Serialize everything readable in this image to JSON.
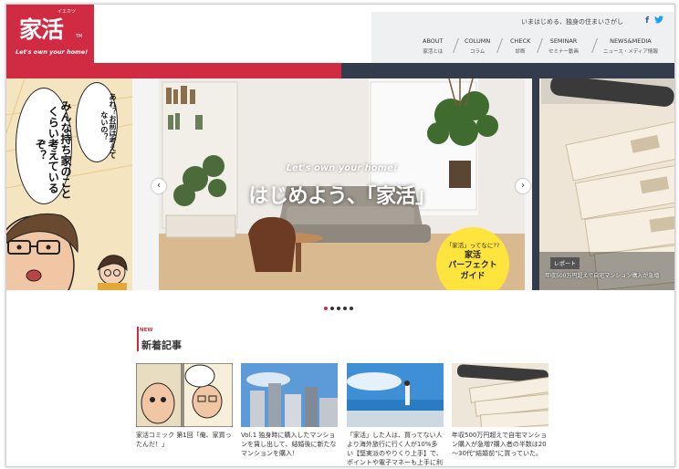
{
  "logo": {
    "sup": "イエカツ",
    "main": "家活",
    "tm": "TM",
    "tag": "Let's own your home!"
  },
  "header": {
    "tagline": "いまはじめる、独身の住まいさがし",
    "facebook": "f",
    "twitter": "🐦",
    "nav": [
      {
        "en": "ABOUT",
        "jp": "家活とは"
      },
      {
        "en": "COLUMN",
        "jp": "コラム"
      },
      {
        "en": "CHECK",
        "jp": "診断"
      },
      {
        "en": "SEMINAR",
        "jp": "セミナー動画"
      },
      {
        "en": "NEWS&MEDIA",
        "jp": "ニュース・メディア情報"
      }
    ]
  },
  "slider": {
    "left_slide": {
      "bubble_main": "みんな持ち家のことくらい考えているぞ？",
      "bubble_small": "あれ？お前は考えてないの？"
    },
    "main_slide": {
      "tagline": "Let's own your home!",
      "headline": "はじめよう、「家活」",
      "badge_line1": "「家活」ってなに??",
      "badge_line2": "家活",
      "badge_line3": "パーフェクト",
      "badge_line4": "ガイド"
    },
    "right_slide": {
      "tag": "レポート",
      "caption": "年収500万円超えで自宅マンション購入が急増"
    },
    "prev_label": "‹",
    "next_label": "›",
    "dots_count": 5,
    "active_dot": 1
  },
  "news": {
    "label_new": "NEW",
    "title": "新着記事",
    "articles": [
      {
        "caption": "家活コミック 第1回「俺、家買ったんだ！」"
      },
      {
        "caption": "Vol.1 独身時に購入したマンションを賃し出して、結婚後に新たなマンションを購入！"
      },
      {
        "caption": "「家活」した人は、買ってない人より海外旅行に行く人が10%多い【堅実派のやりくり上手】で、ポイントや電子マネーも上手に利用"
      },
      {
        "caption": "年収500万円超えで自宅マンション購入が急増?購入者の半数は20～30代\"結婚前\"に買っていた。"
      }
    ]
  },
  "colors": {
    "brand_red": "#d12a43",
    "navy": "#333c4c",
    "badge_yellow": "#ffe43d",
    "nav_bg": "#eef0f1"
  },
  "icons": [
    "facebook-icon",
    "twitter-icon",
    "prev-arrow-icon",
    "next-arrow-icon"
  ]
}
